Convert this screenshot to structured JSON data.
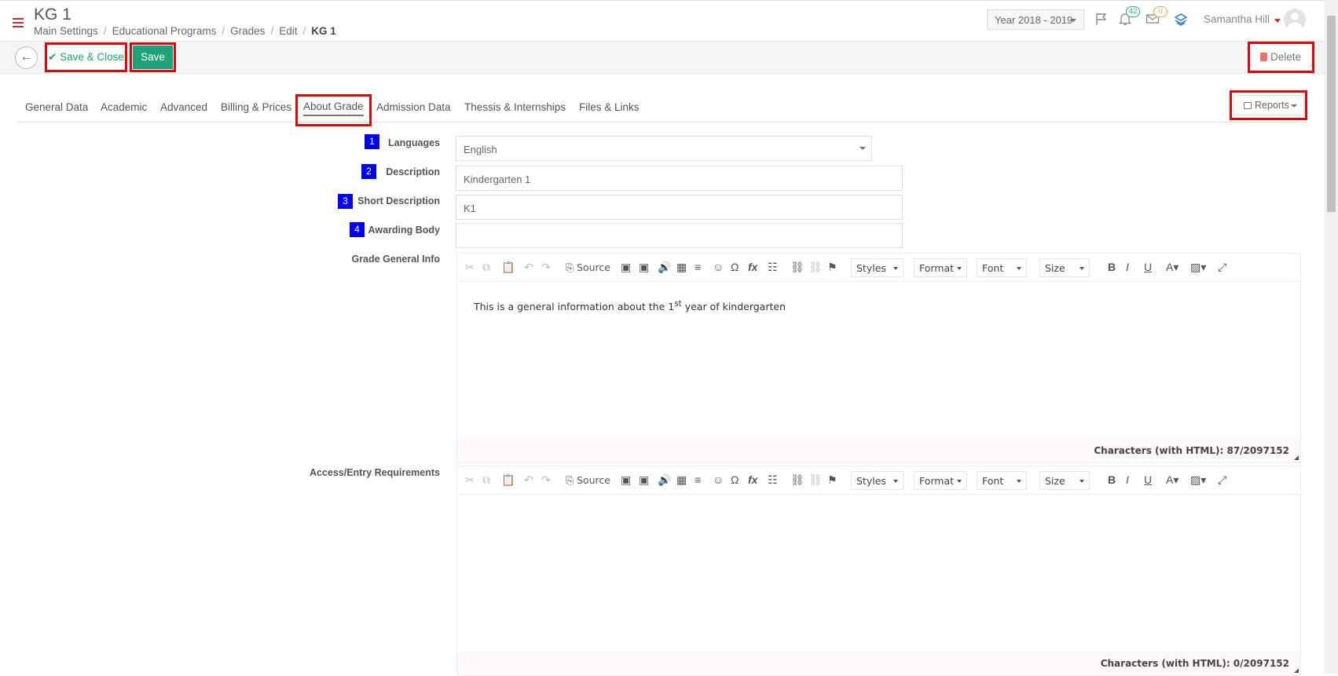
{
  "header": {
    "title": "KG 1",
    "breadcrumb": [
      "Main Settings",
      "Educational Programs",
      "Grades",
      "Edit",
      "KG 1"
    ],
    "year": "Year 2018 - 2019",
    "notifications_count": "42",
    "messages_count": "0",
    "user_name": "Samantha Hill"
  },
  "actions": {
    "save_close": "Save & Close",
    "save": "Save",
    "delete": "Delete",
    "reports": "Reports"
  },
  "tabs": [
    "General Data",
    "Academic",
    "Advanced",
    "Billing & Prices",
    "About Grade",
    "Admission Data",
    "Thessis & Internships",
    "Files & Links"
  ],
  "active_tab": "About Grade",
  "form": {
    "languages": {
      "num": "1",
      "label": "Languages",
      "value": "English"
    },
    "description": {
      "num": "2",
      "label": "Description",
      "value": "Kindergarten 1"
    },
    "short_description": {
      "num": "3",
      "label": "Short Description",
      "value": "K1"
    },
    "awarding_body": {
      "num": "4",
      "label": "Awarding Body",
      "value": ""
    },
    "grade_info": {
      "label": "Grade General Info",
      "text_pre": "This is a general information about the 1",
      "text_sup": "st",
      "text_post": " year of kindergarten",
      "char_count": "Characters (with HTML): 87/2097152"
    },
    "access_req": {
      "label": "Access/Entry Requirements",
      "char_count": "Characters (with HTML): 0/2097152"
    }
  },
  "toolbar": {
    "source": "Source",
    "styles": "Styles",
    "format": "Format",
    "font": "Font",
    "size": "Size"
  },
  "colors": {
    "accent": "#1fa27a",
    "highlight": "#d9080a",
    "badge": "#0000ee"
  }
}
